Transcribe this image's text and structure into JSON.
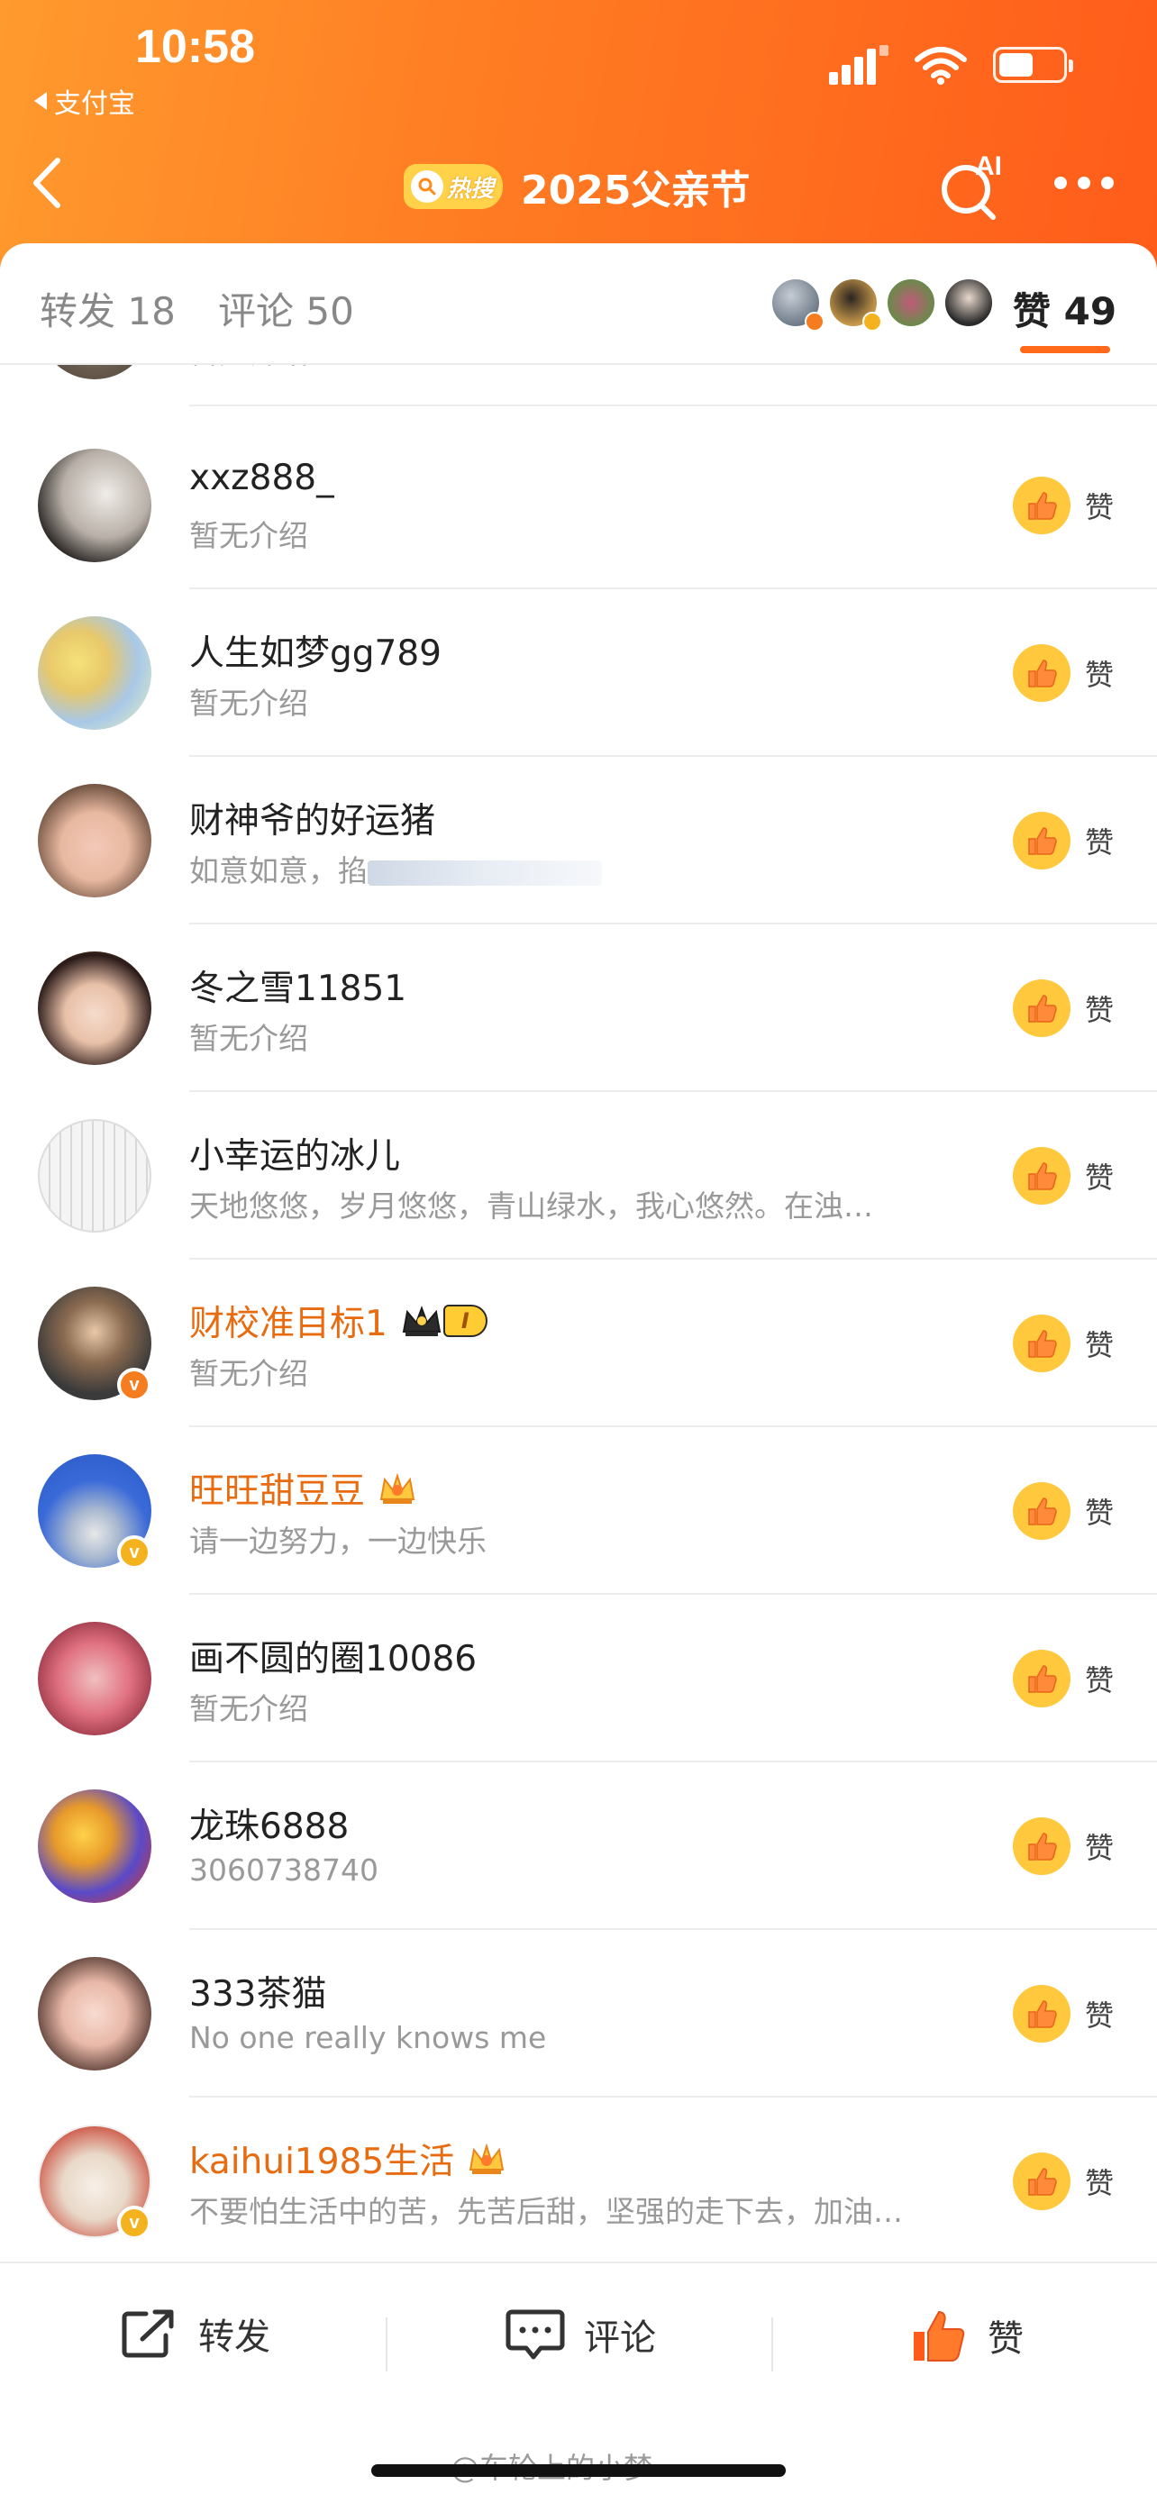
{
  "status_bar": {
    "time": "10:58",
    "back_app": "支付宝"
  },
  "nav": {
    "hot_badge": "热搜",
    "title": "2025父亲节",
    "ai_label": "AI"
  },
  "tabs": {
    "repost": "转发 18",
    "comment": "评论 50",
    "like": "赞 49"
  },
  "likers_colors": [
    "#4a5a6a",
    "#c89a4a",
    "#6a8a4a",
    "#2a2a2a"
  ],
  "list": {
    "like_label": "赞",
    "partial_bio": "暂无介绍",
    "rows": [
      {
        "name": "xxz888_",
        "bio": "暂无介绍",
        "vip": false
      },
      {
        "name": "人生如梦gg789",
        "bio": "暂无介绍",
        "vip": false
      },
      {
        "name": "财神爷的好运猪",
        "bio": "如意如意，掐",
        "vip": false
      },
      {
        "name": "冬之雪11851",
        "bio": "暂无介绍",
        "vip": false
      },
      {
        "name": "小幸运的冰儿",
        "bio": "天地悠悠，岁月悠悠，青山绿水，我心悠然。在浊…",
        "vip": false
      },
      {
        "name": "财校准目标1",
        "bio": "暂无介绍",
        "vip": true,
        "badge_level": "I"
      },
      {
        "name": "旺旺甜豆豆",
        "bio": "请一边努力，一边快乐",
        "vip": true
      },
      {
        "name": "画不圆的圈10086",
        "bio": "暂无介绍",
        "vip": false
      },
      {
        "name": "龙珠6888",
        "bio": "3060738740",
        "vip": false
      },
      {
        "name": "333茶猫",
        "bio": "No one really knows me",
        "vip": false
      },
      {
        "name": "kaihui1985生活",
        "bio": "不要怕生活中的苦，先苦后甜，坚强的走下去，加油…",
        "vip": true
      }
    ]
  },
  "bottom_bar": {
    "repost": "转发",
    "comment": "评论",
    "like": "赞"
  },
  "watermark": "@车轮上的小梦",
  "colors": {
    "accent": "#ff6a1a",
    "vip_name": "#e86b10",
    "like_circle": "#ffc83d"
  }
}
